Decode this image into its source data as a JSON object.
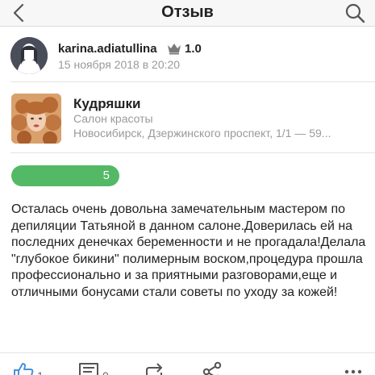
{
  "header": {
    "title": "Отзыв",
    "back_icon": "chevron-left-icon",
    "search_icon": "search-icon"
  },
  "author": {
    "username": "karina.adiatullina",
    "rating": "1.0",
    "date": "15 ноября 2018 в 20:20"
  },
  "salon": {
    "name": "Кудряшки",
    "type": "Салон красоты",
    "address": "Новосибирск, Дзержинского проспект, 1/1 — 59..."
  },
  "score": {
    "value": "5",
    "color": "#54b966"
  },
  "review": {
    "text": "Осталась очень довольна замечательным мастером по депиляции Татьяной в данном салоне.Доверилась ей на последних денечках беременности и не прогадала!Делала \"глубокое бикини\" полимерным воском,процедура прошла профессионально и за приятными разговорами,еще и отличными бонусами стали советы по уходу за кожей!"
  },
  "actions": {
    "likes": "1",
    "comments": "0",
    "share_icon": "share-icon",
    "more_icon": "more-icon"
  }
}
